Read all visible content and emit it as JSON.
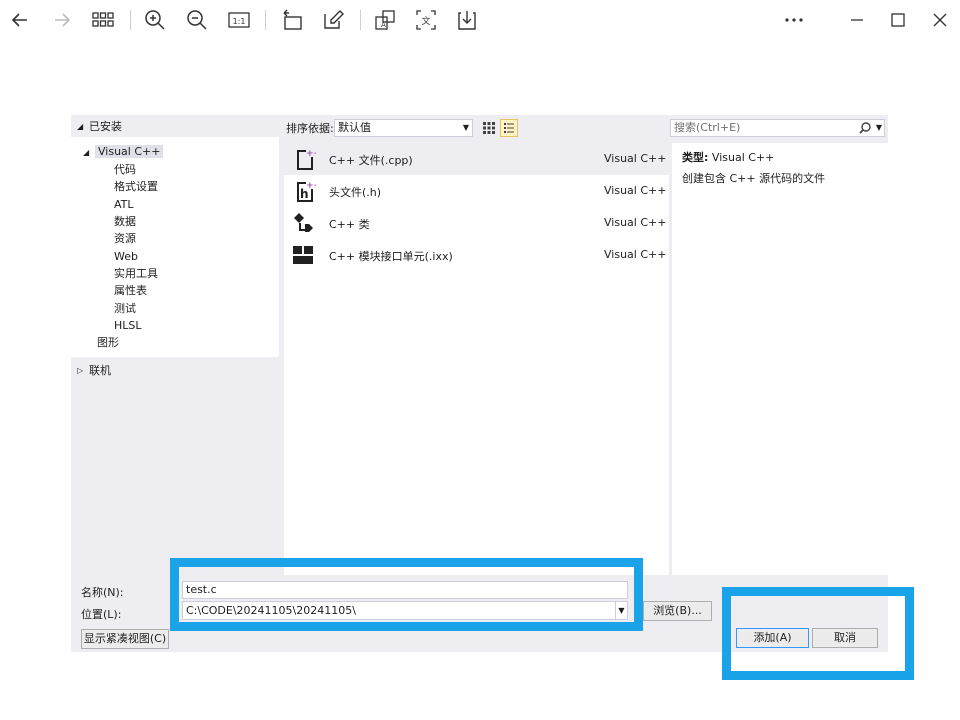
{
  "toolbar": {
    "icons": [
      "back-arrow-icon",
      "forward-arrow-icon",
      "grid-view-icon",
      "zoom-in-icon",
      "zoom-out-icon",
      "actual-size-icon",
      "rotate-icon",
      "edit-icon",
      "ocr-icon",
      "translate-icon",
      "save-icon",
      "more-icon"
    ],
    "window_buttons": [
      "minimize-icon",
      "maximize-icon",
      "close-icon"
    ]
  },
  "left_panel": {
    "installed_header": "已安装",
    "tree": [
      {
        "label": "Visual C++",
        "level": 0,
        "expanded": true,
        "selected": true
      },
      {
        "label": "代码",
        "level": 1
      },
      {
        "label": "格式设置",
        "level": 1
      },
      {
        "label": "ATL",
        "level": 1
      },
      {
        "label": "数据",
        "level": 1
      },
      {
        "label": "资源",
        "level": 1
      },
      {
        "label": "Web",
        "level": 1
      },
      {
        "label": "实用工具",
        "level": 1
      },
      {
        "label": "属性表",
        "level": 1
      },
      {
        "label": "测试",
        "level": 1
      },
      {
        "label": "HLSL",
        "level": 1
      },
      {
        "label": "图形",
        "level": 0
      }
    ],
    "online_header": "联机"
  },
  "sort": {
    "label": "排序依据:",
    "value": "默认值"
  },
  "templates": [
    {
      "name": "C++ 文件(.cpp)",
      "lang": "Visual C++",
      "selected": true,
      "icon": "cpp-file-icon"
    },
    {
      "name": "头文件(.h)",
      "lang": "Visual C++",
      "selected": false,
      "icon": "header-file-icon"
    },
    {
      "name": "C++ 类",
      "lang": "Visual C++",
      "selected": false,
      "icon": "class-icon"
    },
    {
      "name": "C++ 模块接口单元(.ixx)",
      "lang": "Visual C++",
      "selected": false,
      "icon": "module-icon"
    }
  ],
  "search": {
    "placeholder": "搜索(Ctrl+E)"
  },
  "description": {
    "type_label": "类型:",
    "type_value": "Visual C++",
    "text": "创建包含 C++ 源代码的文件"
  },
  "bottom": {
    "name_label": "名称(N):",
    "name_value": "test.c",
    "location_label": "位置(L):",
    "location_value": "C:\\CODE\\20241105\\20241105\\",
    "browse_label": "浏览(B)...",
    "compact_label": "显示紧凑视图(C)",
    "add_label": "添加(A)",
    "cancel_label": "取消"
  },
  "colors": {
    "highlight": "#1aa3e8",
    "dialog_bg": "#eeeef2",
    "selected_row": "#eeeef2"
  }
}
